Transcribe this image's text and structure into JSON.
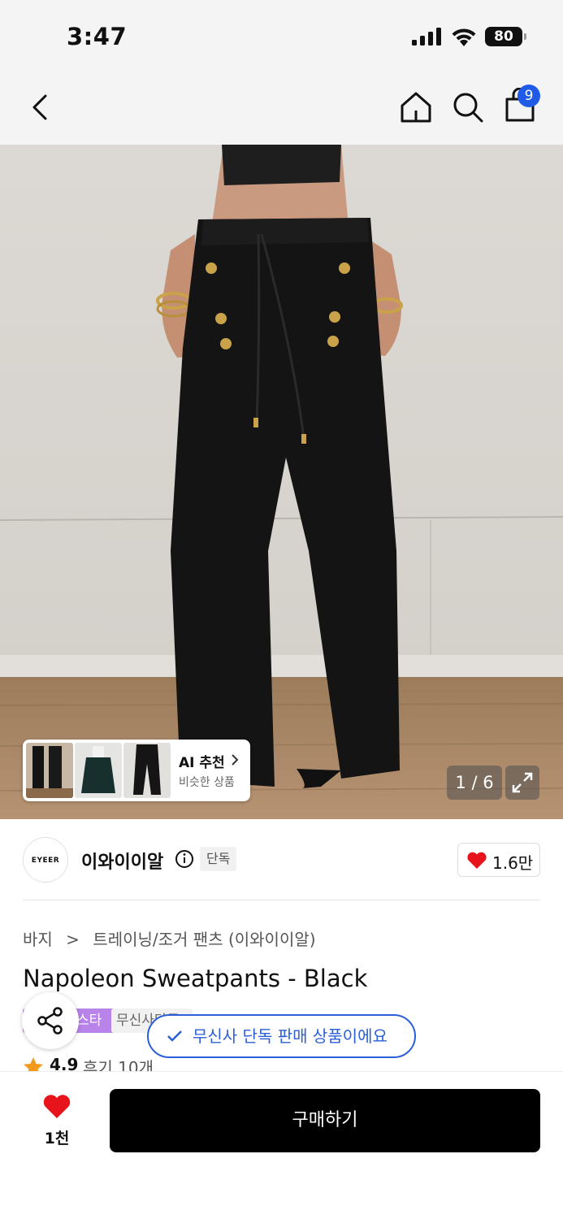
{
  "status_bar": {
    "time": "3:47",
    "battery": "80"
  },
  "nav": {
    "cart_count": "9"
  },
  "gallery": {
    "ai_title": "AI 추천",
    "ai_subtitle": "비슷한 상품",
    "page_counter": "1 / 6"
  },
  "brand": {
    "logo_text": "EYEER",
    "name": "이와이이알",
    "exclusive_tag": "단독",
    "like_count": "1.6만"
  },
  "breadcrumb": {
    "category": "바지",
    "subcategory": "트레이닝/조거 팬츠 (이와이이알)"
  },
  "product": {
    "title": "Napoleon Sweatpants - Black"
  },
  "badges": {
    "purple": "스타",
    "gray": "무신사단독"
  },
  "toast": {
    "text": "무신사 단독 판매 상품이에요"
  },
  "rating": {
    "score": "4.9",
    "reviews": "후기 10개"
  },
  "bottom": {
    "wish_count": "1천",
    "buy_label": "구매하기"
  },
  "colors": {
    "accent_blue": "#2a5fd8",
    "badge_blue": "#1f5be6",
    "heart_red": "#e8141b",
    "badge_purple": "#b884ea",
    "star_orange": "#f29a1c"
  }
}
